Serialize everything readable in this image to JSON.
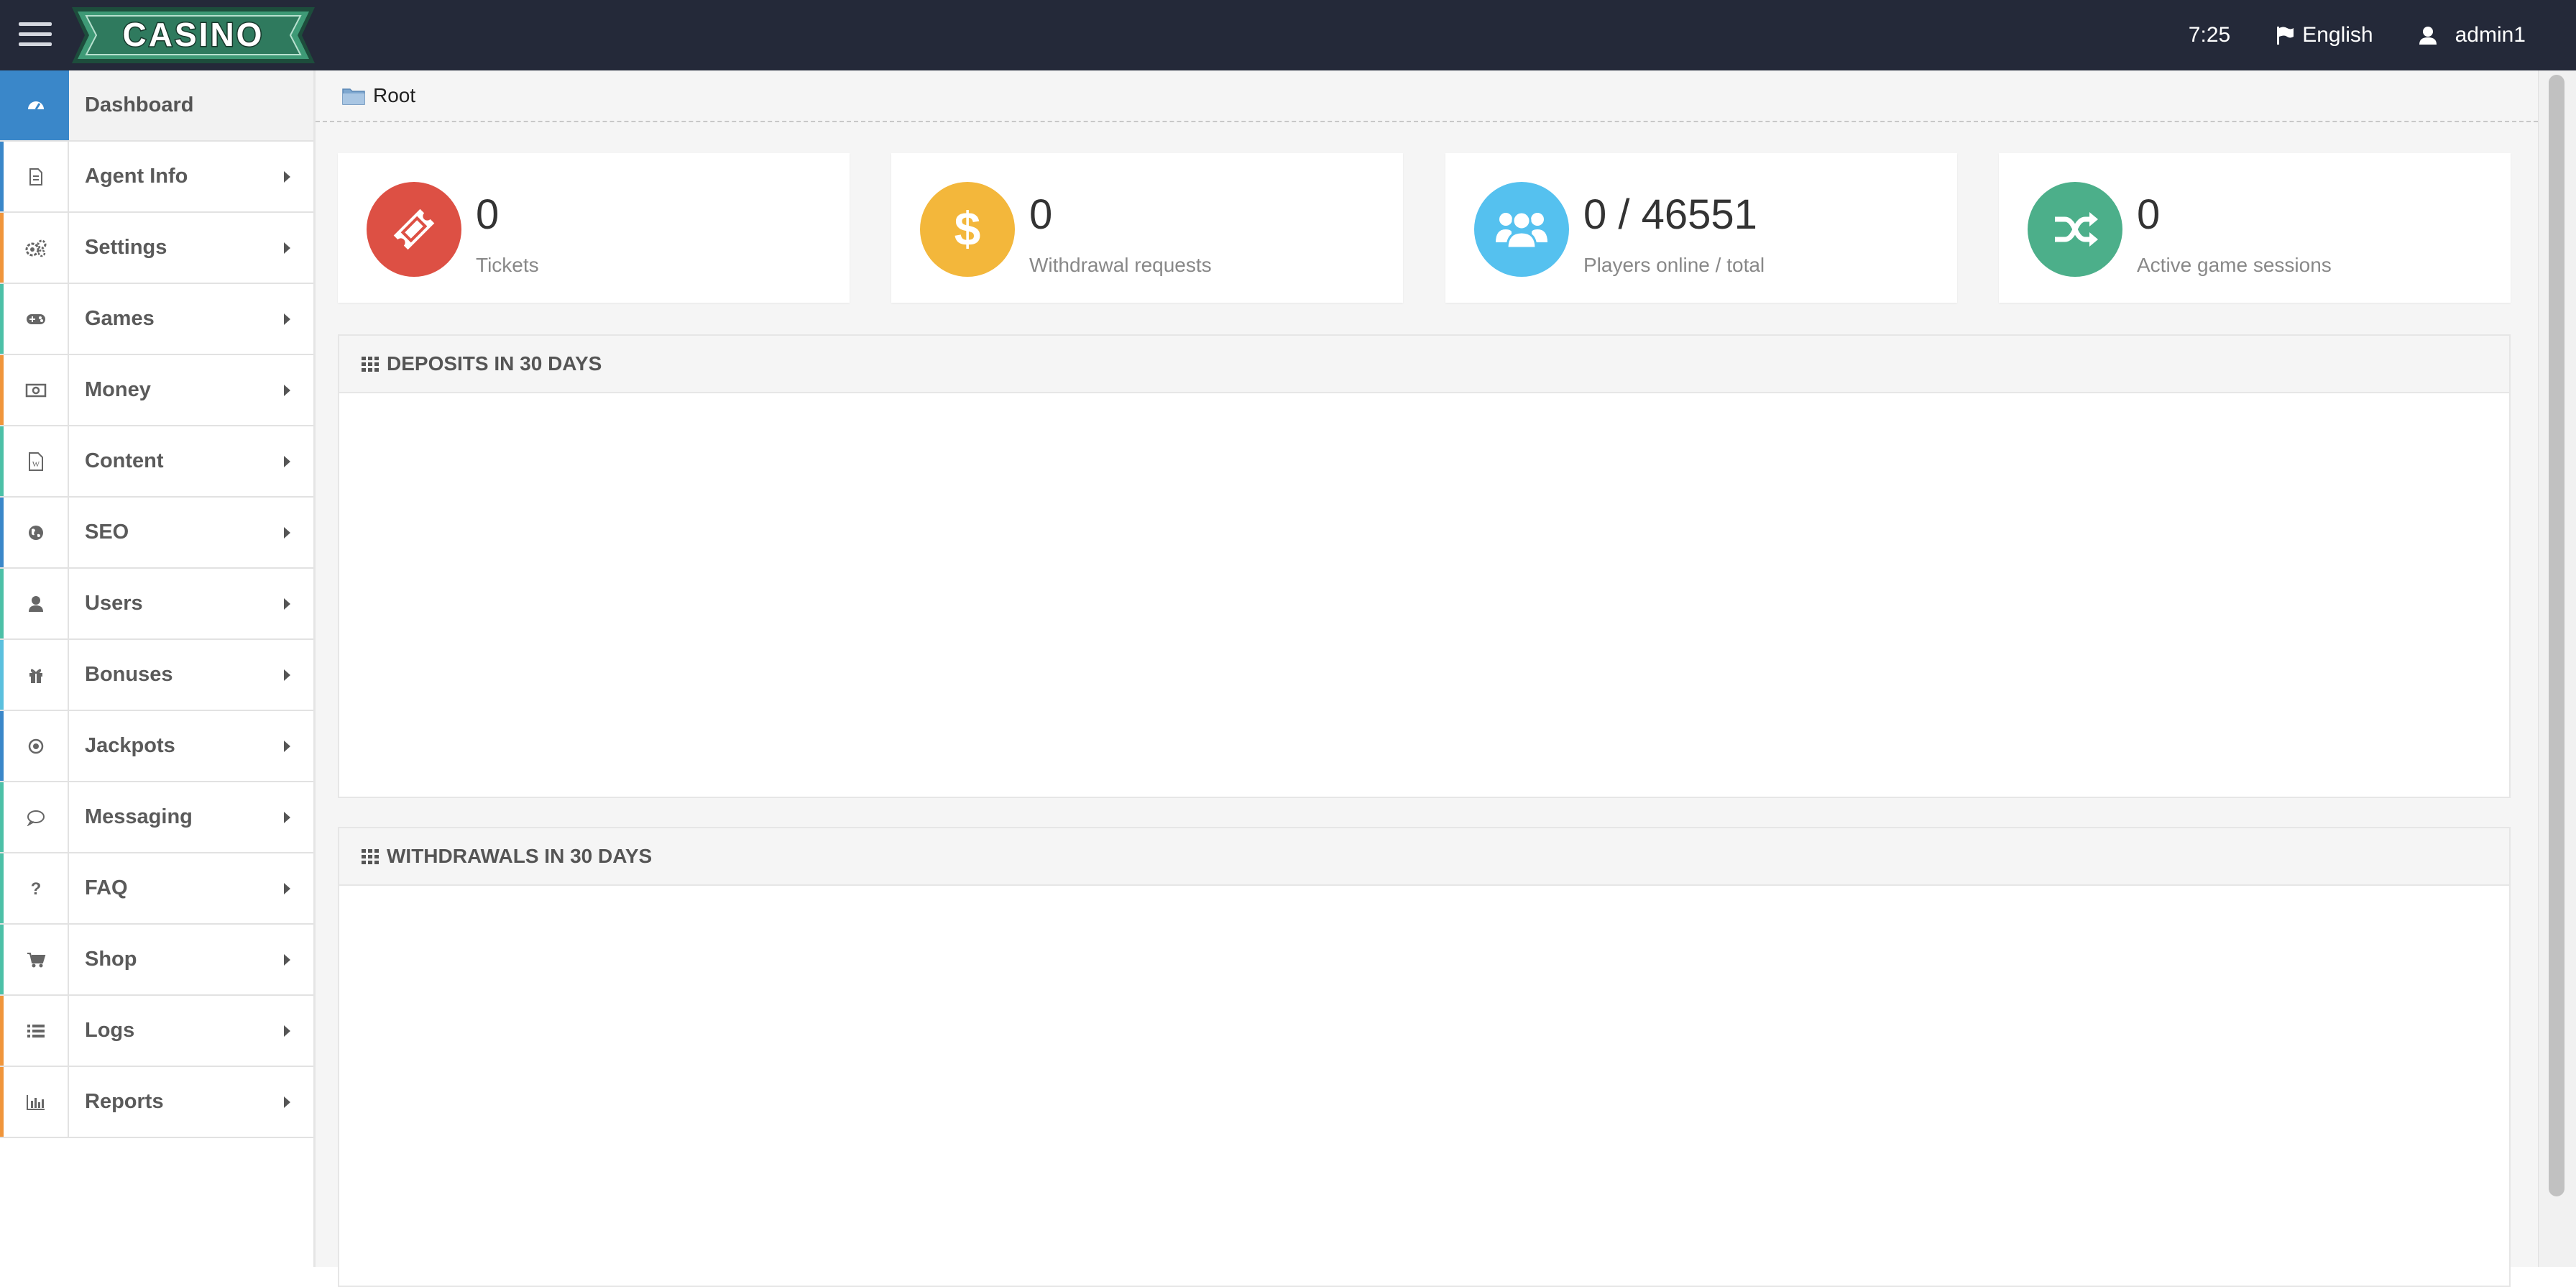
{
  "header": {
    "logo_text": "CASINO",
    "time": "7:25",
    "language": "English",
    "user": "admin1"
  },
  "sidebar": {
    "items": [
      {
        "label": "Dashboard",
        "icon": "dashboard-icon",
        "accent": "#3a87c9",
        "active": true
      },
      {
        "label": "Agent Info",
        "icon": "document-icon",
        "accent": "#3a87c9"
      },
      {
        "label": "Settings",
        "icon": "cogs-icon",
        "accent": "#f0953b"
      },
      {
        "label": "Games",
        "icon": "gamepad-icon",
        "accent": "#4cc0a7"
      },
      {
        "label": "Money",
        "icon": "money-icon",
        "accent": "#f0953b"
      },
      {
        "label": "Content",
        "icon": "word-file-icon",
        "accent": "#4cc0a7"
      },
      {
        "label": "SEO",
        "icon": "globe-icon",
        "accent": "#3a87c9"
      },
      {
        "label": "Users",
        "icon": "user-icon",
        "accent": "#4cc0a7"
      },
      {
        "label": "Bonuses",
        "icon": "gift-icon",
        "accent": "#5bc0de"
      },
      {
        "label": "Jackpots",
        "icon": "target-icon",
        "accent": "#3a87c9"
      },
      {
        "label": "Messaging",
        "icon": "chat-icon",
        "accent": "#4cc0a7"
      },
      {
        "label": "FAQ",
        "icon": "question-icon",
        "accent": "#4cc0a7"
      },
      {
        "label": "Shop",
        "icon": "cart-icon",
        "accent": "#4cc0a7"
      },
      {
        "label": "Logs",
        "icon": "list-icon",
        "accent": "#f0953b"
      },
      {
        "label": "Reports",
        "icon": "bar-chart-icon",
        "accent": "#f0953b"
      }
    ]
  },
  "breadcrumb": {
    "root": "Root"
  },
  "stats": [
    {
      "value": "0",
      "caption": "Tickets",
      "color": "#dd5044",
      "icon": "ticket-icon"
    },
    {
      "value": "0",
      "caption": "Withdrawal requests",
      "color": "#f3b73b",
      "icon": "dollar-icon"
    },
    {
      "value": "0 / 46551",
      "caption": "Players online / total",
      "color": "#55c1ef",
      "icon": "users-icon"
    },
    {
      "value": "0",
      "caption": "Active game sessions",
      "color": "#4caf8a",
      "icon": "shuffle-icon"
    }
  ],
  "panels": {
    "deposits_title": "DEPOSITS IN 30 DAYS",
    "withdrawals_title": "WITHDRAWALS IN 30 DAYS"
  }
}
